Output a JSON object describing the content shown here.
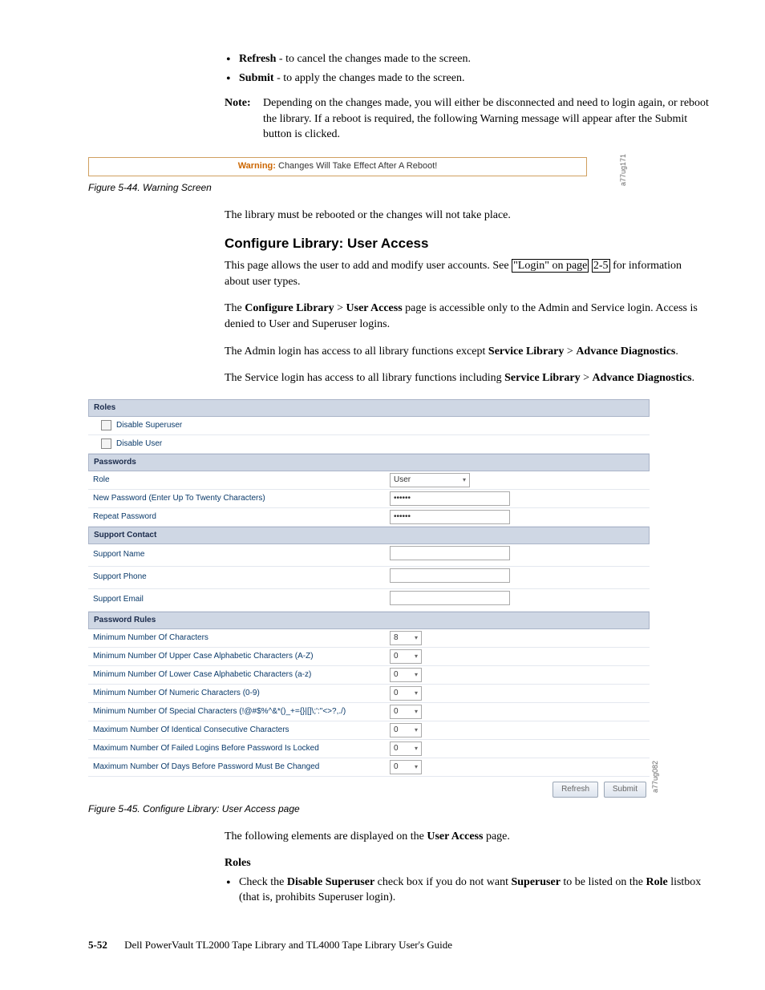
{
  "intro": {
    "bullets": [
      {
        "bold": "Refresh",
        "rest": " - to cancel the changes made to the screen."
      },
      {
        "bold": "Submit",
        "rest": " - to apply the changes made to the screen."
      }
    ],
    "note_label": "Note:",
    "note_text": "Depending on the changes made, you will either be disconnected and need to login again, or reboot the library. If a reboot is required, the following Warning message will appear after the Submit button is clicked."
  },
  "warning_fig": {
    "prefix": "Warning:",
    "message": " Changes Will Take Effect After A Reboot!",
    "side_code": "a77ug171",
    "caption": "Figure 5-44. Warning Screen"
  },
  "after_warning": "The library must be rebooted or the changes will not take place.",
  "section": {
    "heading": "Configure Library: User Access",
    "p1_pre": "This page allows the user to add and modify user accounts. See ",
    "p1_link1": "\"Login\" on page",
    "p1_link2": "2-5",
    "p1_post": " for information about user types.",
    "p2": {
      "pre": "The ",
      "b1": "Configure Library",
      "gt": " > ",
      "b2": "User Access",
      "post": " page is accessible only to the Admin and Service login. Access is denied to User and Superuser logins."
    },
    "p3": {
      "pre": "The Admin login has access to all library functions except ",
      "b1": "Service Library",
      "gt": " > ",
      "b2": "Advance Diagnostics",
      "post": "."
    },
    "p4": {
      "pre": "The Service login has access to all library functions including ",
      "b1": "Service Library",
      "gt": " > ",
      "b2": "Advance Diagnostics",
      "post": "."
    }
  },
  "ua": {
    "bands": {
      "roles": "Roles",
      "passwords": "Passwords",
      "support": "Support Contact",
      "rules": "Password Rules"
    },
    "roles": {
      "disable_superuser": "Disable Superuser",
      "disable_user": "Disable User"
    },
    "passwords": {
      "role_label": "Role",
      "role_value": "User",
      "newpw_label": "New Password (Enter Up To Twenty Characters)",
      "newpw_value": "••••••",
      "repeat_label": "Repeat Password",
      "repeat_value": "••••••"
    },
    "support": {
      "name": "Support Name",
      "phone": "Support Phone",
      "email": "Support Email"
    },
    "rules": [
      {
        "label": "Minimum Number Of Characters",
        "value": "8"
      },
      {
        "label": "Minimum Number Of Upper Case Alphabetic Characters (A-Z)",
        "value": "0"
      },
      {
        "label": "Minimum Number Of Lower Case Alphabetic Characters (a-z)",
        "value": "0"
      },
      {
        "label": "Minimum Number Of Numeric Characters (0-9)",
        "value": "0"
      },
      {
        "label": "Minimum Number Of Special Characters (!@#$%^&*()_+={}|[]\\;':\"<>?,./)",
        "value": "0"
      },
      {
        "label": "Maximum Number Of Identical Consecutive Characters",
        "value": "0"
      },
      {
        "label": "Maximum Number Of Failed Logins Before Password Is Locked",
        "value": "0"
      },
      {
        "label": "Maximum Number Of Days Before Password Must Be Changed",
        "value": "0"
      }
    ],
    "buttons": {
      "refresh": "Refresh",
      "submit": "Submit"
    },
    "side_code": "a77ug082",
    "caption": "Figure 5-45. Configure Library: User Access page"
  },
  "after_ua": {
    "lead": "The following elements are displayed on the ",
    "lead_b": "User Access",
    "lead_post": " page.",
    "roles_term": "Roles",
    "roles_bullet_pre": "Check the ",
    "roles_bullet_b1": "Disable Superuser",
    "roles_bullet_mid": " check box if you do not want ",
    "roles_bullet_b2": "Superuser",
    "roles_bullet_post1": " to be listed on the ",
    "roles_bullet_b3": "Role",
    "roles_bullet_post2": " listbox (that is, prohibits Superuser login)."
  },
  "footer": {
    "page": "5-52",
    "title": "Dell PowerVault TL2000 Tape Library and TL4000 Tape Library User's Guide"
  }
}
